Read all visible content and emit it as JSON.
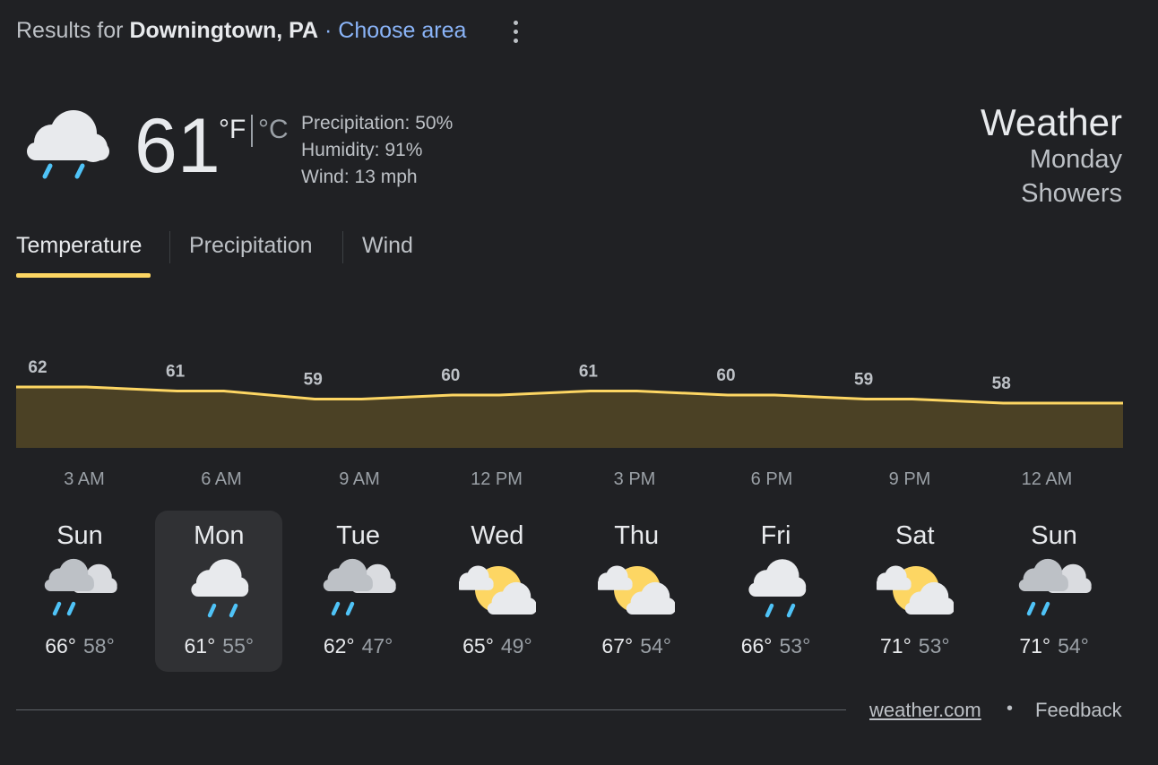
{
  "header": {
    "prefix": "Results for",
    "location": "Downingtown, PA",
    "separator": "·",
    "choose_area": "Choose area",
    "more_icon": "more-vert-icon"
  },
  "current": {
    "icon": "rain-cloud-icon",
    "temp": "61",
    "unit_f": "°F",
    "unit_c": "°C",
    "precipitation": "Precipitation: 50%",
    "humidity": "Humidity: 91%",
    "wind": "Wind: 13 mph",
    "title": "Weather",
    "day": "Monday",
    "condition": "Showers"
  },
  "tabs": [
    {
      "label": "Temperature",
      "active": true
    },
    {
      "label": "Precipitation",
      "active": false
    },
    {
      "label": "Wind",
      "active": false
    }
  ],
  "colors": {
    "accent": "#fdd663",
    "fill": "#4b4125",
    "link": "#8ab4f8",
    "background": "#202124"
  },
  "chart_data": {
    "type": "area",
    "x": [
      "3 AM",
      "6 AM",
      "9 AM",
      "12 PM",
      "3 PM",
      "6 PM",
      "9 PM",
      "12 AM"
    ],
    "series": [
      {
        "values": [
          62,
          61,
          59,
          60,
          61,
          60,
          59,
          58
        ]
      }
    ],
    "labels": [
      "62",
      "61",
      "59",
      "60",
      "61",
      "60",
      "59",
      "58"
    ],
    "ylim": [
      50,
      64
    ],
    "grid": false
  },
  "daily": [
    {
      "day": "Sun",
      "icon": "rain-partly-cloudy-icon",
      "hi": "66°",
      "lo": "58°",
      "selected": false
    },
    {
      "day": "Mon",
      "icon": "rain-cloud-icon",
      "hi": "61°",
      "lo": "55°",
      "selected": true
    },
    {
      "day": "Tue",
      "icon": "rain-partly-cloudy-icon",
      "hi": "62°",
      "lo": "47°",
      "selected": false
    },
    {
      "day": "Wed",
      "icon": "partly-cloudy-icon",
      "hi": "65°",
      "lo": "49°",
      "selected": false
    },
    {
      "day": "Thu",
      "icon": "partly-cloudy-icon",
      "hi": "67°",
      "lo": "54°",
      "selected": false
    },
    {
      "day": "Fri",
      "icon": "rain-cloud-icon",
      "hi": "66°",
      "lo": "53°",
      "selected": false
    },
    {
      "day": "Sat",
      "icon": "partly-cloudy-icon",
      "hi": "71°",
      "lo": "53°",
      "selected": false
    },
    {
      "day": "Sun",
      "icon": "rain-partly-cloudy-icon",
      "hi": "71°",
      "lo": "54°",
      "selected": false
    }
  ],
  "footer": {
    "source": "weather.com",
    "bullet": "•",
    "feedback": "Feedback"
  }
}
